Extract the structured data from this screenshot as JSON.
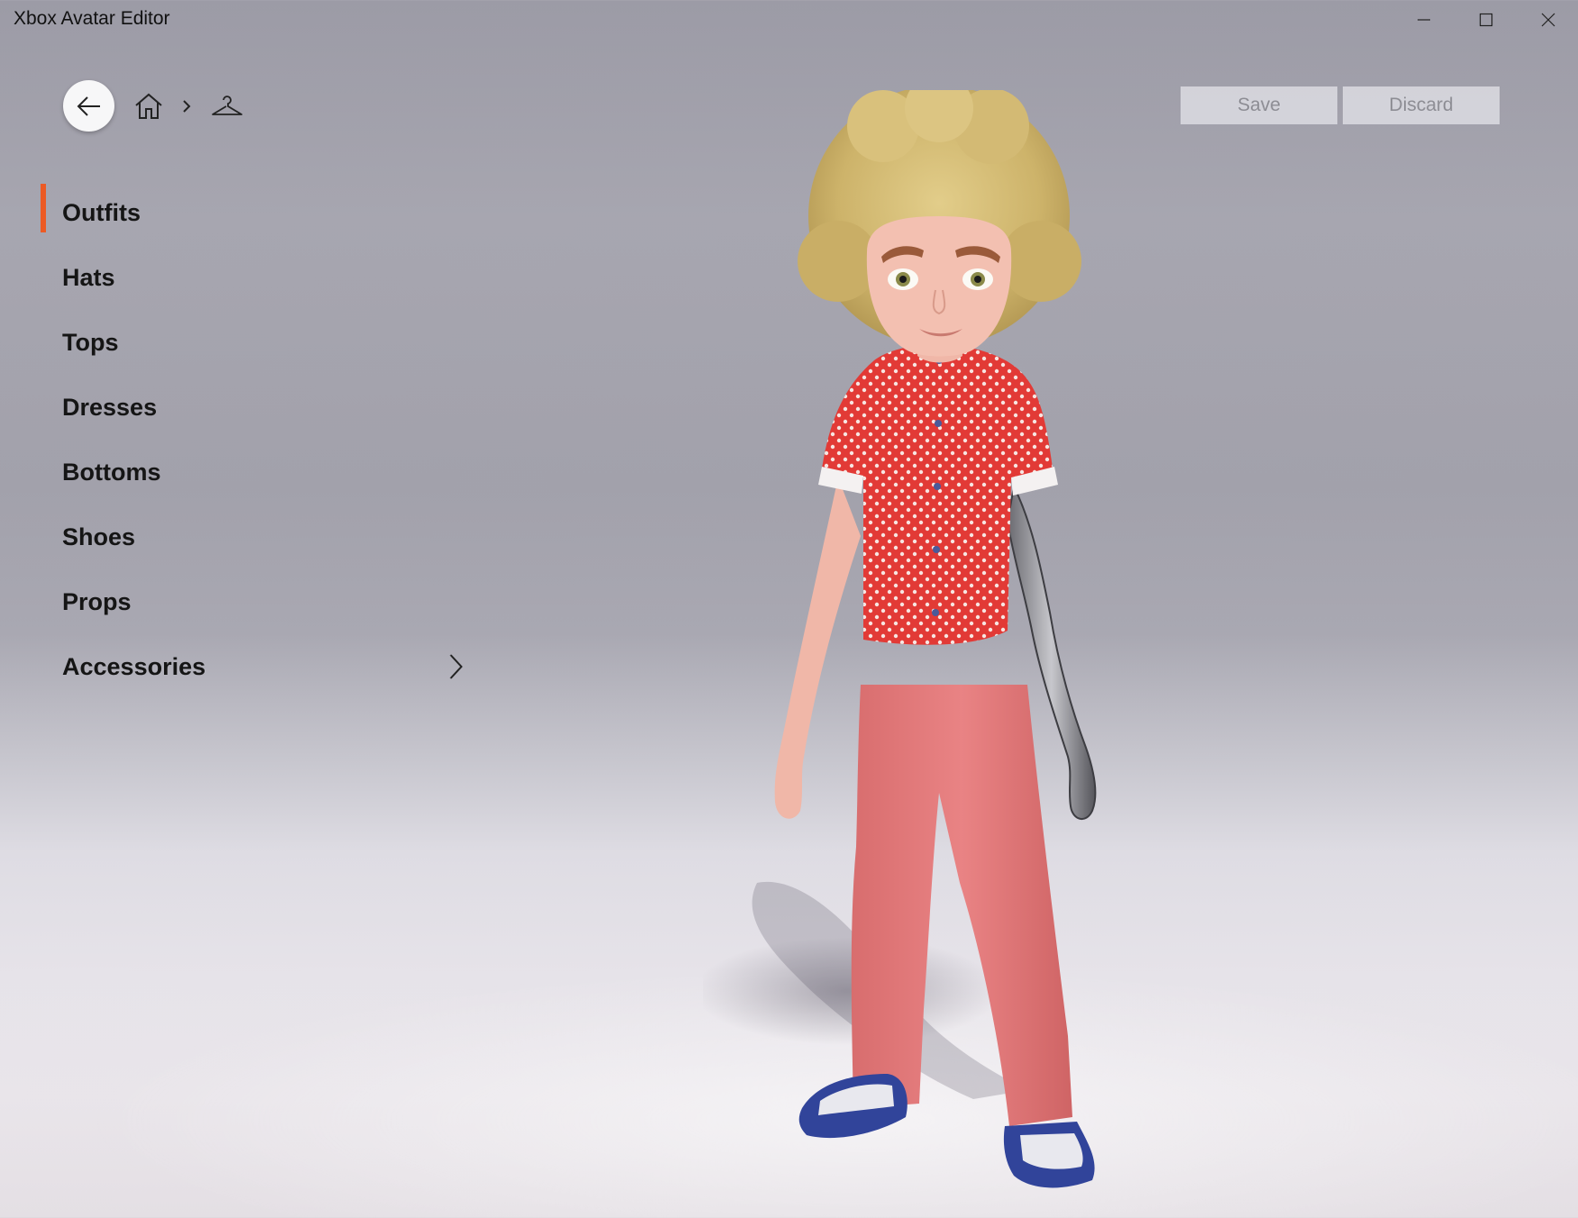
{
  "window": {
    "title": "Xbox Avatar Editor"
  },
  "header": {
    "breadcrumb": [
      "home-icon",
      "hanger-icon"
    ]
  },
  "actions": {
    "save_label": "Save",
    "discard_label": "Discard"
  },
  "menu": {
    "items": [
      {
        "label": "Outfits",
        "active": true
      },
      {
        "label": "Hats"
      },
      {
        "label": "Tops"
      },
      {
        "label": "Dresses"
      },
      {
        "label": "Bottoms"
      },
      {
        "label": "Shoes"
      },
      {
        "label": "Props"
      },
      {
        "label": "Accessories",
        "has_submenu": true
      }
    ]
  },
  "colors": {
    "accent": "#ec5a24",
    "shirt": "#e23a36",
    "pants": "#e3797a",
    "hair": "#d8bf76"
  }
}
